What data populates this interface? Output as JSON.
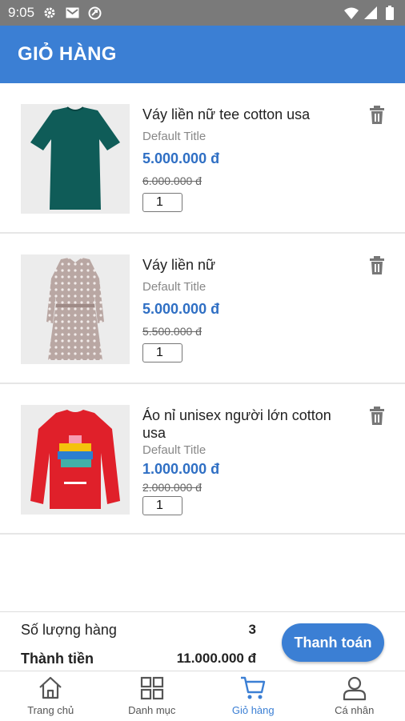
{
  "status_bar": {
    "time": "9:05",
    "icons": [
      "gear-icon",
      "mail-icon",
      "sync-icon",
      "wifi-icon",
      "signal-icon",
      "battery-icon"
    ]
  },
  "header": {
    "title": "GIỎ HÀNG"
  },
  "colors": {
    "primary": "#3b7fd4",
    "price": "#2f6fc4"
  },
  "cart": {
    "items": [
      {
        "name": "Váy liền nữ tee cotton usa",
        "variant": "Default Title",
        "price": "5.000.000 đ",
        "old_price": "6.000.000 đ",
        "quantity": "1",
        "image": "teal-tshirt-dress"
      },
      {
        "name": "Váy liền nữ",
        "variant": "Default Title",
        "price": "5.000.000 đ",
        "old_price": "5.500.000 đ",
        "quantity": "1",
        "image": "patterned-shirt-dress"
      },
      {
        "name": "Áo nỉ unisex người lớn cotton usa",
        "variant": "Default Title",
        "price": "1.000.000 đ",
        "old_price": "2.000.000 đ",
        "quantity": "1",
        "image": "red-sweatshirt"
      }
    ]
  },
  "summary": {
    "quantity_label": "Số lượng hàng",
    "quantity_value": "3",
    "total_label": "Thành tiền",
    "total_value": "11.000.000 đ",
    "checkout_label": "Thanh toán"
  },
  "nav": {
    "items": [
      {
        "label": "Trang chủ",
        "icon": "home-icon"
      },
      {
        "label": "Danh mục",
        "icon": "grid-icon"
      },
      {
        "label": "Giỏ hàng",
        "icon": "cart-icon",
        "active": true
      },
      {
        "label": "Cá nhân",
        "icon": "user-icon"
      }
    ]
  }
}
